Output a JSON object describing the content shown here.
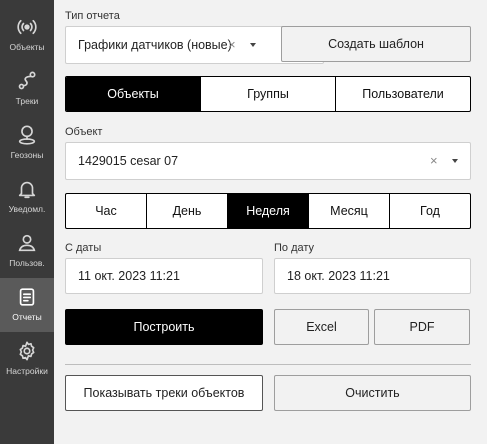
{
  "sidebar": {
    "items": [
      {
        "label": "Объекты",
        "icon": "broadcast-icon"
      },
      {
        "label": "Треки",
        "icon": "route-icon"
      },
      {
        "label": "Геозоны",
        "icon": "location-pin-icon"
      },
      {
        "label": "Уведомл.",
        "icon": "bell-icon"
      },
      {
        "label": "Пользов.",
        "icon": "user-icon"
      },
      {
        "label": "Отчеты",
        "icon": "report-icon"
      },
      {
        "label": "Настройки",
        "icon": "gear-icon"
      }
    ],
    "active": "Отчеты"
  },
  "report_type": {
    "label": "Тип отчета",
    "value": "Графики датчиков (новые)",
    "clear_symbol": "×"
  },
  "create_template_label": "Создать шаблон",
  "entity_tabs": [
    "Объекты",
    "Группы",
    "Пользователи"
  ],
  "entity_tab_active": "Объекты",
  "object_field": {
    "label": "Объект",
    "value": "1429015 cesar 07",
    "clear_symbol": "×"
  },
  "period_tabs": [
    "Час",
    "День",
    "Неделя",
    "Месяц",
    "Год"
  ],
  "period_tab_active": "Неделя",
  "date_from": {
    "label": "С даты",
    "value": "11 окт. 2023 11:21"
  },
  "date_to": {
    "label": "По дату",
    "value": "18 окт. 2023 11:21"
  },
  "actions": {
    "build_label": "Построить",
    "excel_label": "Excel",
    "pdf_label": "PDF",
    "show_tracks_label": "Показывать треки объектов",
    "clear_label": "Очистить"
  }
}
